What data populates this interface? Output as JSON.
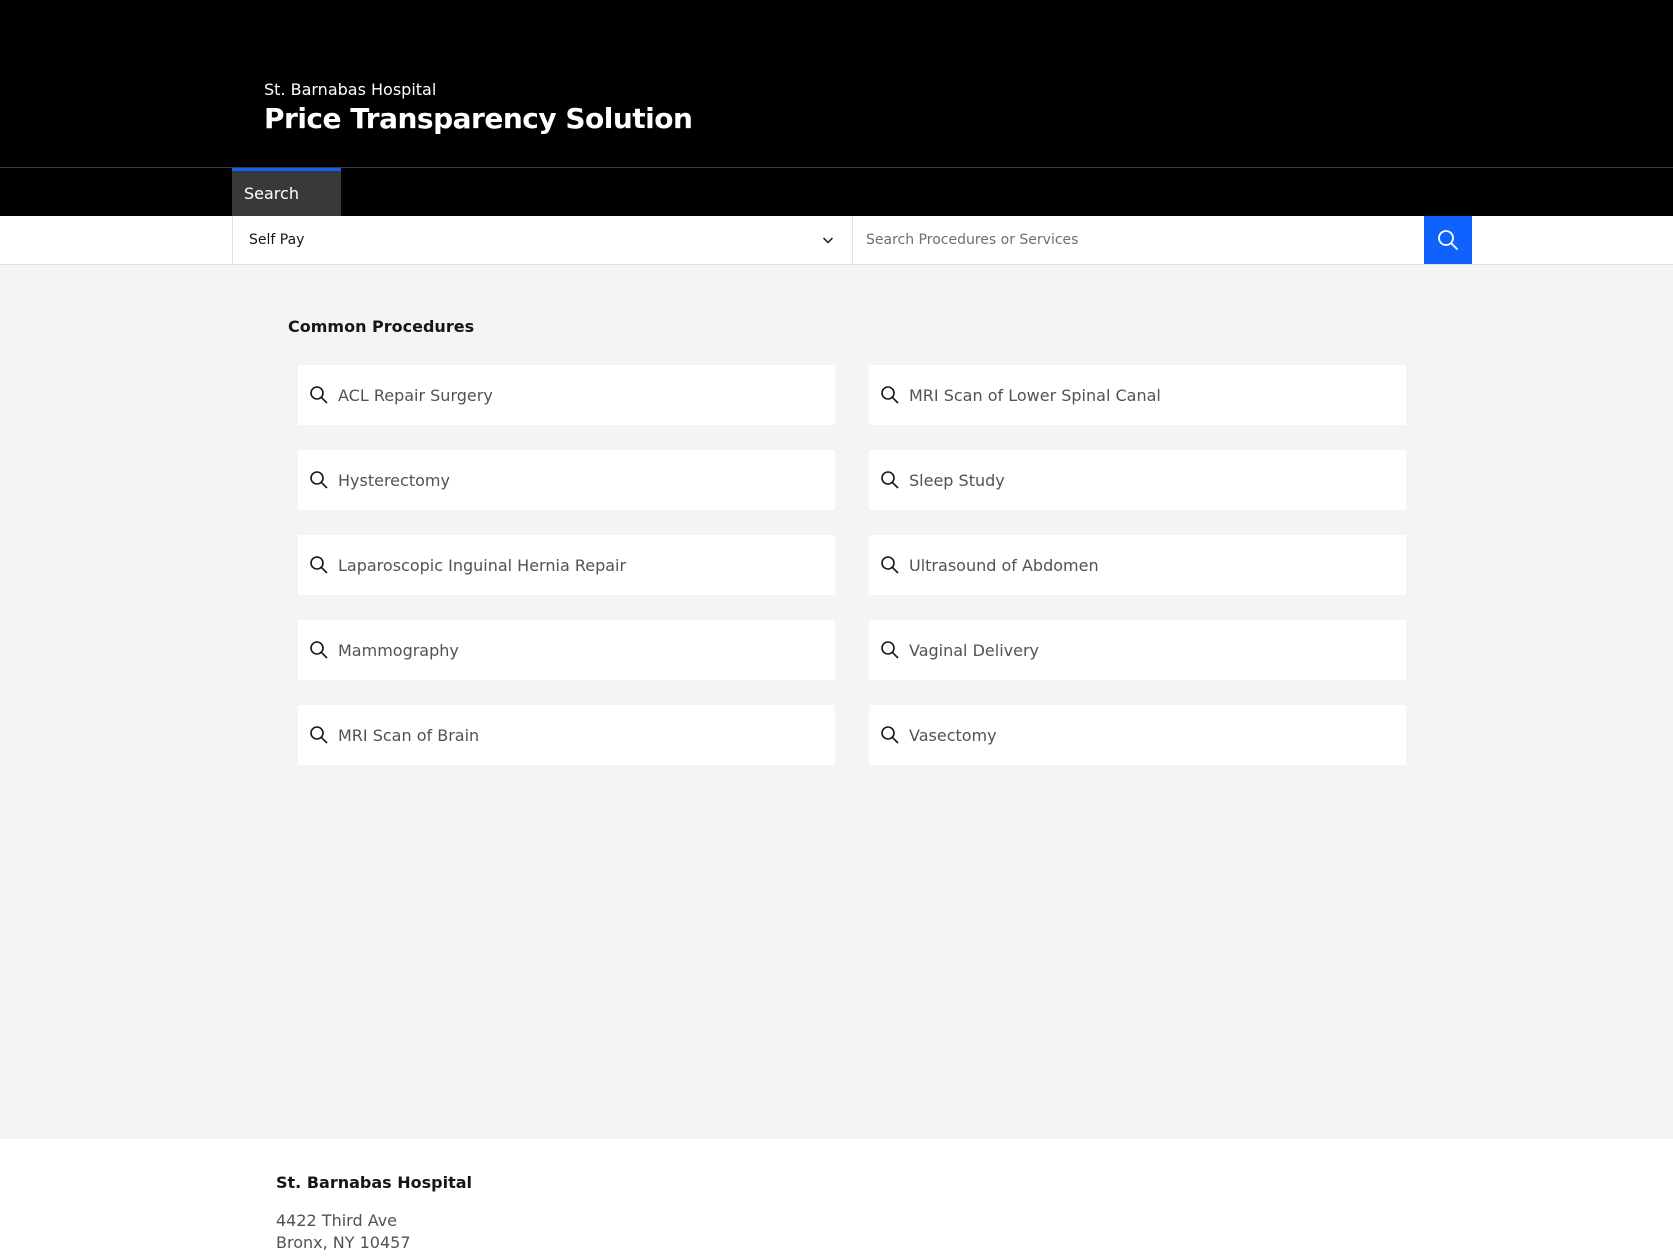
{
  "header": {
    "hospital_name": "St. Barnabas Hospital",
    "app_title": "Price Transparency Solution"
  },
  "nav": {
    "tabs": [
      {
        "label": "Search"
      }
    ]
  },
  "search": {
    "payer_selected": "Self Pay",
    "placeholder": "Search Procedures or Services",
    "search_icon": "search-icon"
  },
  "main": {
    "section_title": "Common Procedures",
    "procedures": [
      {
        "label": "ACL Repair Surgery"
      },
      {
        "label": "MRI Scan of Lower Spinal Canal"
      },
      {
        "label": "Hysterectomy"
      },
      {
        "label": "Sleep Study"
      },
      {
        "label": "Laparoscopic Inguinal Hernia Repair"
      },
      {
        "label": "Ultrasound of Abdomen"
      },
      {
        "label": "Mammography"
      },
      {
        "label": "Vaginal Delivery"
      },
      {
        "label": "MRI Scan of Brain"
      },
      {
        "label": "Vasectomy"
      }
    ]
  },
  "footer": {
    "name": "St. Barnabas Hospital",
    "address_line1": "4422 Third Ave",
    "address_line2": "Bronx, NY 10457"
  },
  "colors": {
    "accent": "#0f62fe",
    "header_bg": "#000000",
    "page_bg": "#f4f4f4",
    "tab_active_bg": "#393939"
  }
}
